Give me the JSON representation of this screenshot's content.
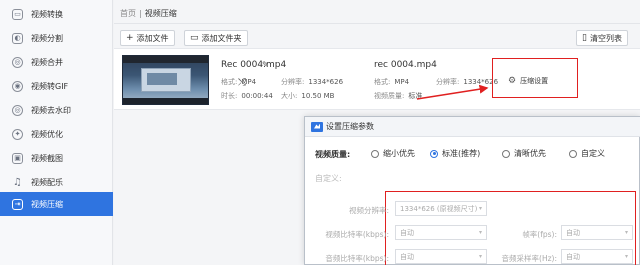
{
  "sidebar": {
    "items": [
      {
        "label": "视频转换",
        "icon": "video-convert-icon",
        "glyph": "▭"
      },
      {
        "label": "视频分割",
        "icon": "video-split-icon",
        "glyph": "◐"
      },
      {
        "label": "视频合并",
        "icon": "video-merge-icon",
        "glyph": "◎"
      },
      {
        "label": "视频转GIF",
        "icon": "video-gif-icon",
        "glyph": "◉"
      },
      {
        "label": "视频去水印",
        "icon": "watermark-icon",
        "glyph": "◎"
      },
      {
        "label": "视频优化",
        "icon": "optimize-icon",
        "glyph": "✦"
      },
      {
        "label": "视频截图",
        "icon": "screenshot-icon",
        "glyph": "▣"
      },
      {
        "label": "视频配乐",
        "icon": "music-icon",
        "glyph": "♫"
      },
      {
        "label": "视频压缩",
        "icon": "compress-icon",
        "glyph": "⇥"
      }
    ],
    "active_index": 8
  },
  "breadcrumb": {
    "home": "首页",
    "sep": "|",
    "current": "视频压缩"
  },
  "toolbar": {
    "add_file": "添加文件",
    "add_folder": "添加文件夹",
    "clear_list": "清空列表"
  },
  "file": {
    "source": {
      "name": "Rec 0004.mp4",
      "format_label": "格式:",
      "format": "MP4",
      "res_label": "分辨率:",
      "resolution": "1334*626",
      "duration_label": "时长:",
      "duration": "00:00:44",
      "size_label": "大小:",
      "size": "10.50 MB"
    },
    "output": {
      "name": "rec 0004.mp4",
      "format_label": "格式:",
      "format": "MP4",
      "res_label": "分辨率:",
      "resolution": "1334*626",
      "quality_label": "视频质量:",
      "quality": "标准"
    },
    "compress_settings": "压缩设置"
  },
  "dialog": {
    "title": "设置压缩参数",
    "quality_label": "视频质量:",
    "options": [
      "缩小优先",
      "标准(推荐)",
      "清晰优先",
      "自定义"
    ],
    "selected_option": 1,
    "custom_label": "自定义:",
    "fields": {
      "resolution_label": "视频分辨率:",
      "resolution_value": "1334*626 (原视频尺寸)",
      "bitrate_label": "视频比特率(kbps):",
      "bitrate_value": "自动",
      "fps_label": "帧率(fps):",
      "fps_value": "自动",
      "audio_bitrate_label": "音频比特率(kbps):",
      "audio_bitrate_value": "自动",
      "sample_rate_label": "音频采样率(Hz):",
      "sample_rate_value": "自动"
    }
  },
  "colors": {
    "accent": "#2f74e0",
    "annotation": "#e02020"
  }
}
